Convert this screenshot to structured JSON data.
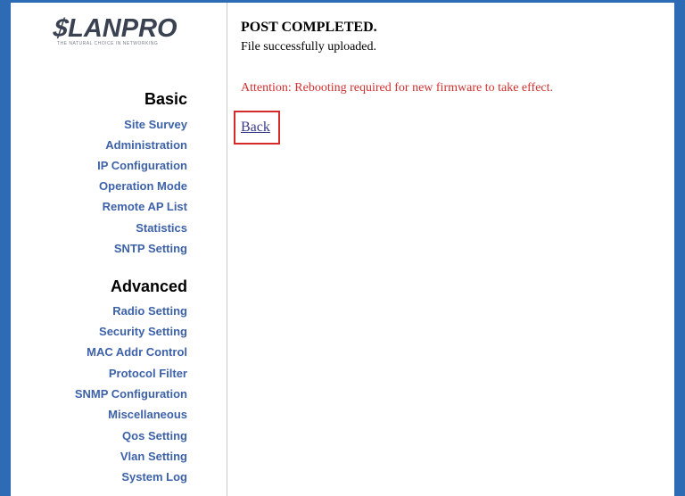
{
  "brand": {
    "logo_text": "LANPRO",
    "tagline": "THE NATURAL CHOICE IN NETWORKING"
  },
  "sidebar": {
    "basic": {
      "title": "Basic",
      "items": [
        "Site Survey",
        "Administration",
        "IP Configuration",
        "Operation Mode",
        "Remote AP List",
        "Statistics",
        "SNTP Setting"
      ]
    },
    "advanced": {
      "title": "Advanced",
      "items": [
        "Radio Setting",
        "Security Setting",
        "MAC Addr Control",
        "Protocol Filter",
        "SNMP Configuration",
        "Miscellaneous",
        "Qos Setting",
        "Vlan Setting",
        "System Log"
      ]
    }
  },
  "main": {
    "title": "POST COMPLETED.",
    "message": "File successfully uploaded.",
    "attention": "Attention: Rebooting required for new firmware to take effect.",
    "back_label": "Back"
  },
  "colors": {
    "frame": "#2d6cb4",
    "nav_link": "#3d62a8",
    "attention": "#d03030",
    "highlight_box": "#d42a2a"
  }
}
